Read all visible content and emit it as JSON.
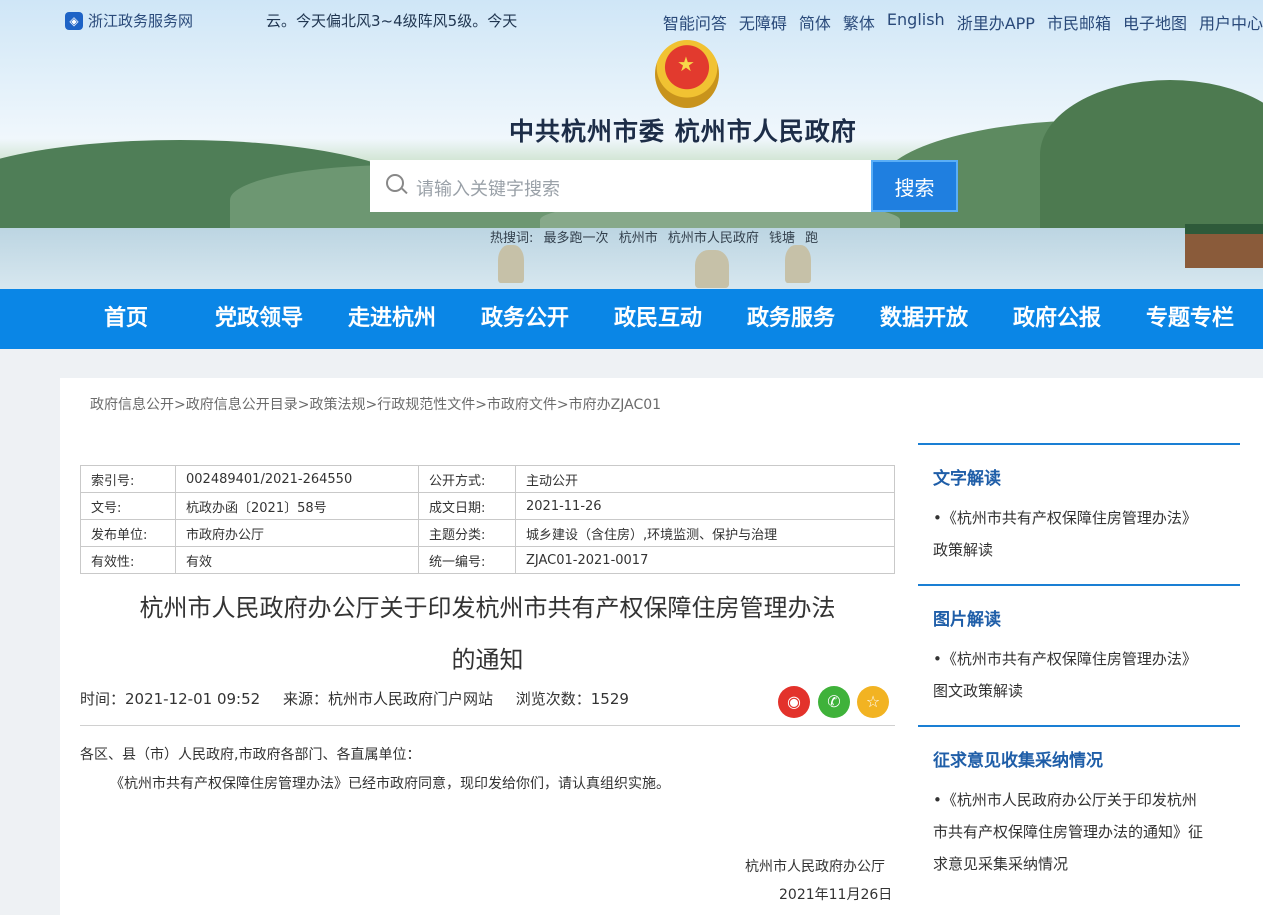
{
  "topbar": {
    "logo_glyph": "◈",
    "site_name": "浙江政务服务网",
    "weather": "云。今天偏北风3~4级阵风5级。今天",
    "links": [
      "智能问答",
      "无障碍",
      "简体",
      "繁体",
      "English",
      "浙里办APP",
      "市民邮箱",
      "电子地图",
      "用户中心"
    ]
  },
  "header": {
    "title": "中共杭州市委  杭州市人民政府",
    "emblem_glyph": "★",
    "search_placeholder": "请输入关键字搜索",
    "search_button": "搜索",
    "hot_label": "热搜词:",
    "hot_words": [
      "最多跑一次",
      "杭州市",
      "杭州市人民政府",
      "钱塘",
      "跑"
    ]
  },
  "nav": {
    "items": [
      "首页",
      "党政领导",
      "走进杭州",
      "政务公开",
      "政民互动",
      "政务服务",
      "数据开放",
      "政府公报",
      "专题专栏"
    ]
  },
  "breadcrumb": "政府信息公开>政府信息公开目录>政策法规>行政规范性文件>市政府文件>市府办ZJAC01",
  "meta": {
    "rows": [
      [
        "索引号:",
        "002489401/2021-264550",
        "公开方式:",
        "主动公开"
      ],
      [
        "文号:",
        "杭政办函〔2021〕58号",
        "成文日期:",
        "2021-11-26"
      ],
      [
        "发布单位:",
        "市政府办公厅",
        "主题分类:",
        "城乡建设（含住房）,环境监测、保护与治理"
      ],
      [
        "有效性:",
        "有效",
        "统一编号:",
        "ZJAC01-2021-0017"
      ]
    ]
  },
  "doc": {
    "title_line1": "杭州市人民政府办公厅关于印发杭州市共有产权保障住房管理办法",
    "title_line2": "的通知",
    "time": "时间：2021-12-01 09:52",
    "source": "来源：杭州市人民政府门户网站",
    "views": "浏览次数：1529",
    "share_glyphs": [
      "◉",
      "✆",
      "☆"
    ],
    "greeting": "各区、县（市）人民政府,市政府各部门、各直属单位：",
    "para1": "《杭州市共有产权保障住房管理办法》已经市政府同意，现印发给你们，请认真组织实施。",
    "signer": "杭州市人民政府办公厅",
    "date": "2021年11月26日"
  },
  "sidebar": {
    "sections": [
      {
        "title": "文字解读",
        "link_line1": "•《杭州市共有产权保障住房管理办法》",
        "link_line2": "政策解读",
        "link_line3": ""
      },
      {
        "title": "图片解读",
        "link_line1": "•《杭州市共有产权保障住房管理办法》",
        "link_line2": "图文政策解读",
        "link_line3": ""
      },
      {
        "title": "征求意见收集采纳情况",
        "link_line1": "•《杭州市人民政府办公厅关于印发杭州",
        "link_line2": "市共有产权保障住房管理办法的通知》征",
        "link_line3": "求意见采集采纳情况"
      }
    ]
  },
  "colors": {
    "nav_bg": "#0a86e6",
    "search_btn": "#1f7fe0",
    "weibo": "#e3322b",
    "wechat": "#3fb23a",
    "favorite": "#f2b322"
  }
}
